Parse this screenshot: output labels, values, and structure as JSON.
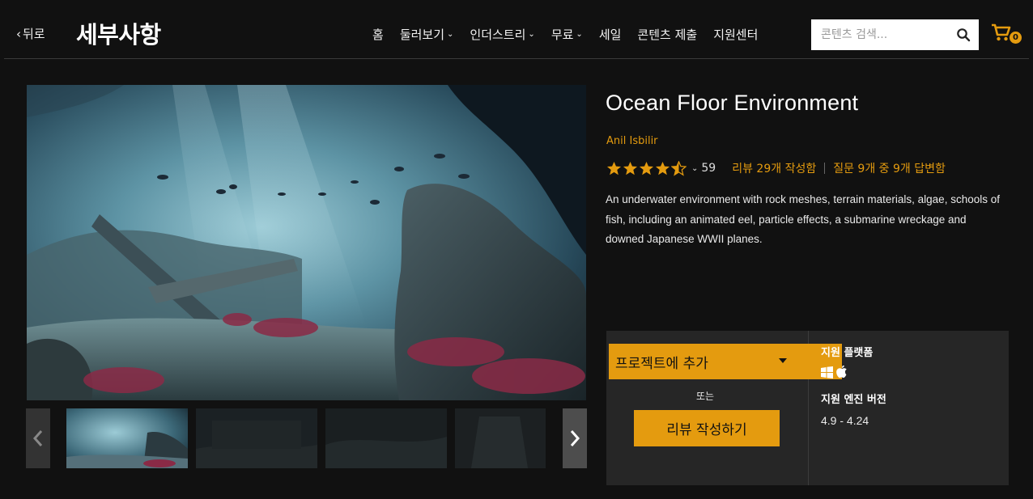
{
  "header": {
    "back_label": "뒤로",
    "page_title": "세부사항",
    "nav": [
      {
        "label": "홈",
        "dropdown": false
      },
      {
        "label": "둘러보기",
        "dropdown": true
      },
      {
        "label": "인더스트리",
        "dropdown": true
      },
      {
        "label": "무료",
        "dropdown": true
      },
      {
        "label": "세일",
        "dropdown": false
      },
      {
        "label": "콘텐츠 제출",
        "dropdown": false
      },
      {
        "label": "지원센터",
        "dropdown": false
      }
    ],
    "search_placeholder": "콘텐츠 검색...",
    "cart_count": "0"
  },
  "product": {
    "title": "Ocean Floor Environment",
    "author": "Anil Isbilir",
    "rating_stars": 4.5,
    "rating_count": "59",
    "reviews_link": "리뷰 29개 작성함",
    "qa_link": "질문 9개 중 9개 답변함",
    "description": "An underwater environment with rock meshes, terrain materials, algae, schools of fish, including an animated eel, particle effects, a submarine wreckage and downed Japanese WWII planes."
  },
  "purchase": {
    "add_to_project": "프로젝트에 추가",
    "or": "또는",
    "write_review": "리뷰 작성하기"
  },
  "info": {
    "platform_heading": "지원 플랫폼",
    "platforms": [
      "windows-icon",
      "apple-icon"
    ],
    "engine_heading": "지원 엔진 버전",
    "engine_versions": "4.9 - 4.24"
  },
  "gallery": {
    "thumbnail_count": 4,
    "selected_index": 0
  },
  "colors": {
    "accent": "#e49b0f",
    "background": "#111111",
    "panel": "#262626"
  }
}
